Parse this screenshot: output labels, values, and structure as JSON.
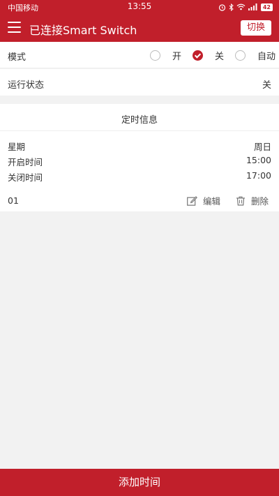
{
  "status_bar": {
    "carrier": "中国移动",
    "time": "13:55",
    "battery": "42"
  },
  "header": {
    "title": "已连接Smart Switch",
    "switch_label": "切换"
  },
  "mode": {
    "label": "模式",
    "options": [
      "开",
      "关",
      "自动"
    ],
    "selected": "关"
  },
  "run_state": {
    "label": "运行状态",
    "value": "关"
  },
  "schedule": {
    "title": "定时信息",
    "day_label": "星期",
    "day_value": "周日",
    "start_label": "开启时间",
    "start_value": "15:00",
    "end_label": "关闭时间",
    "end_value": "17:00",
    "index": "01",
    "edit_label": "编辑",
    "delete_label": "删除"
  },
  "footer": {
    "add_label": "添加时间"
  },
  "colors": {
    "brand": "#c11f2b"
  }
}
